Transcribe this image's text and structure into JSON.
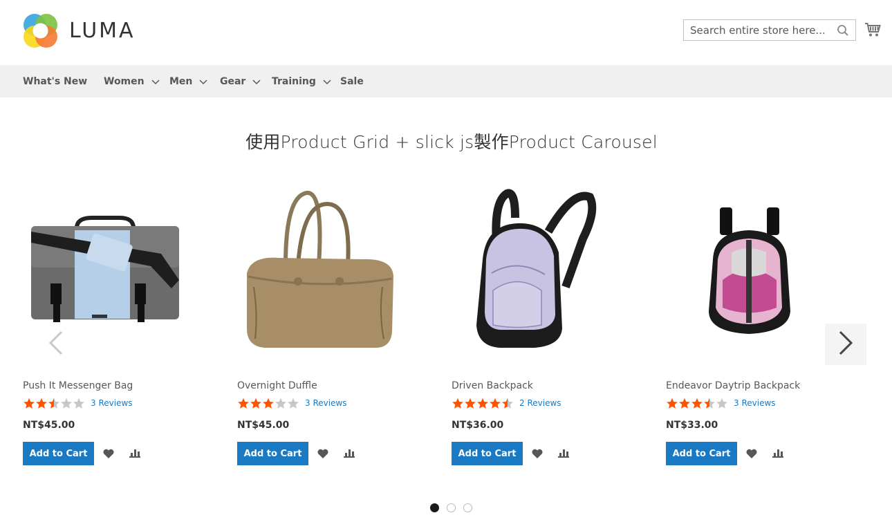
{
  "header": {
    "logo_text": "LUMA",
    "search_placeholder": "Search entire store here...",
    "cart_icon": "cart-icon"
  },
  "nav": {
    "items": [
      {
        "label": "What's New",
        "has_dropdown": false
      },
      {
        "label": "Women",
        "has_dropdown": true
      },
      {
        "label": "Men",
        "has_dropdown": true
      },
      {
        "label": "Gear",
        "has_dropdown": true
      },
      {
        "label": "Training",
        "has_dropdown": true
      },
      {
        "label": "Sale",
        "has_dropdown": false
      }
    ]
  },
  "section": {
    "title": "使用Product Grid + slick js製作Product Carousel"
  },
  "products": [
    {
      "name": "Push It Messenger Bag",
      "rating": 2.5,
      "reviews": "3  Reviews",
      "price": "NT$45.00",
      "add_label": "Add to Cart"
    },
    {
      "name": "Overnight Duffle",
      "rating": 3,
      "reviews": "3  Reviews",
      "price": "NT$45.00",
      "add_label": "Add to Cart"
    },
    {
      "name": "Driven Backpack",
      "rating": 4.5,
      "reviews": "2  Reviews",
      "price": "NT$36.00",
      "add_label": "Add to Cart"
    },
    {
      "name": "Endeavor Daytrip Backpack",
      "rating": 3.5,
      "reviews": "3  Reviews",
      "price": "NT$33.00",
      "add_label": "Add to Cart"
    }
  ],
  "carousel": {
    "page_count": 3,
    "active_page": 1
  },
  "colors": {
    "accent": "#1979c3",
    "star": "#ff5501",
    "star_empty": "#c7c7c7",
    "nav_bg": "#f0f0f0"
  }
}
